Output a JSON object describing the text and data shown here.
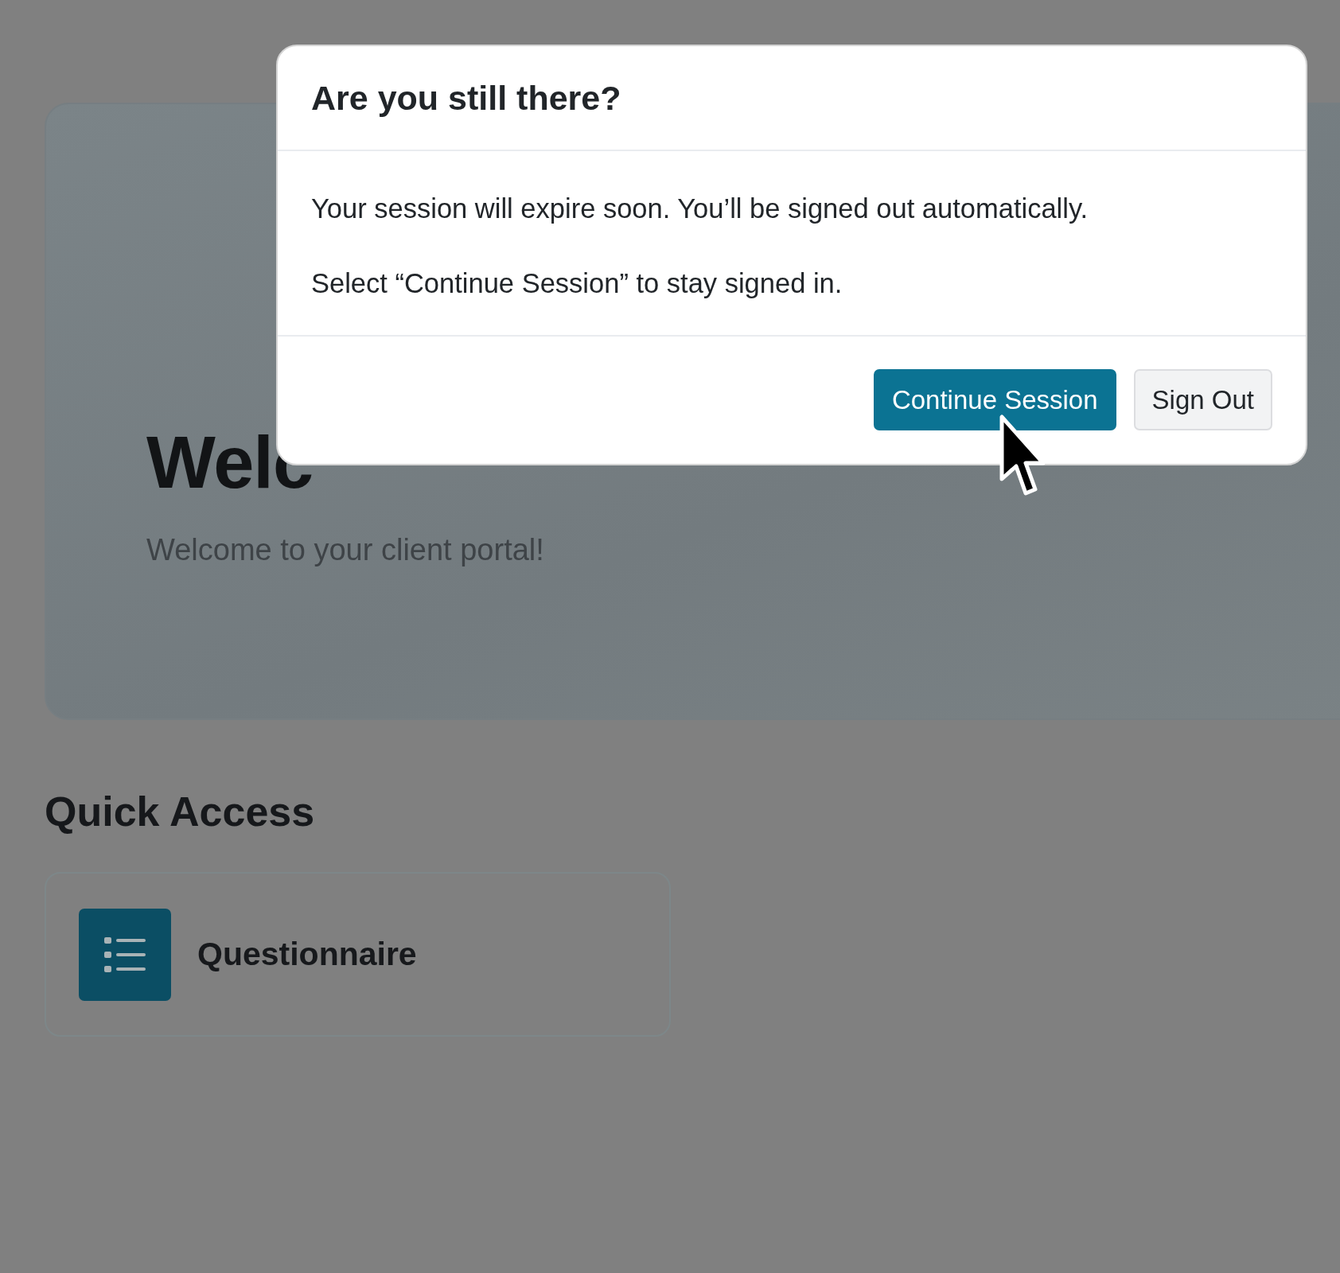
{
  "hero": {
    "title": "Welc",
    "subtitle": "Welcome to your client portal!"
  },
  "quick_access": {
    "heading": "Quick Access",
    "cards": [
      {
        "label": "Questionnaire"
      }
    ]
  },
  "modal": {
    "title": "Are you still there?",
    "paragraphs": [
      "Your session will expire soon. You’ll be signed out automatically.",
      "Select “Continue Session” to stay signed in."
    ],
    "buttons": [
      {
        "label": "Continue Session",
        "kind": "primary"
      },
      {
        "label": "Sign Out",
        "kind": "secondary"
      }
    ]
  }
}
